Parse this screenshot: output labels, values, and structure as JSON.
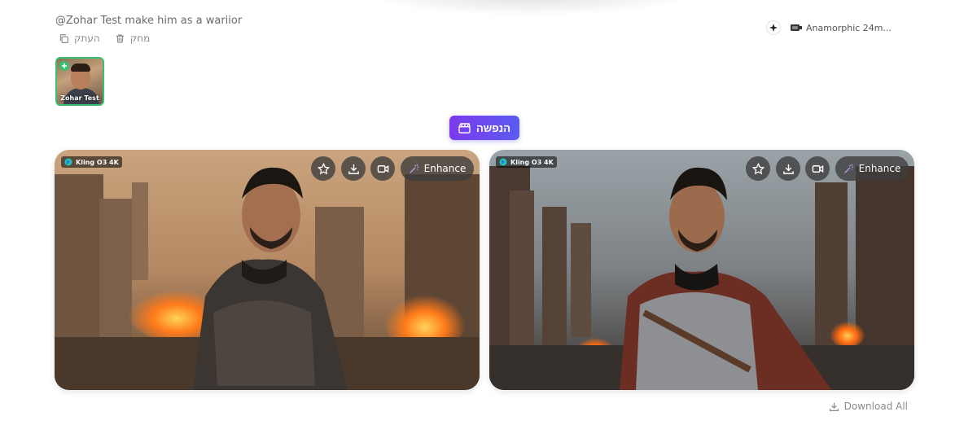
{
  "prompt": {
    "text": "@Zohar Test make him as a wariior"
  },
  "actions": {
    "copy_label": "העתק",
    "delete_label": "מחק"
  },
  "meta": {
    "icon": "sparkle-icon",
    "lens_label": "Anamorphic 24m..."
  },
  "reference": {
    "name": "Zohar Test"
  },
  "animate": {
    "label": "הנפשה"
  },
  "results": [
    {
      "model": "Kling O3 4K",
      "enhance_label": "Enhance"
    },
    {
      "model": "Kling O3 4K",
      "enhance_label": "Enhance"
    }
  ],
  "footer": {
    "download_all_label": "Download All"
  },
  "colors": {
    "accent_start": "#7c3aed",
    "accent_end": "#5b5bf0",
    "success": "#38c172"
  }
}
